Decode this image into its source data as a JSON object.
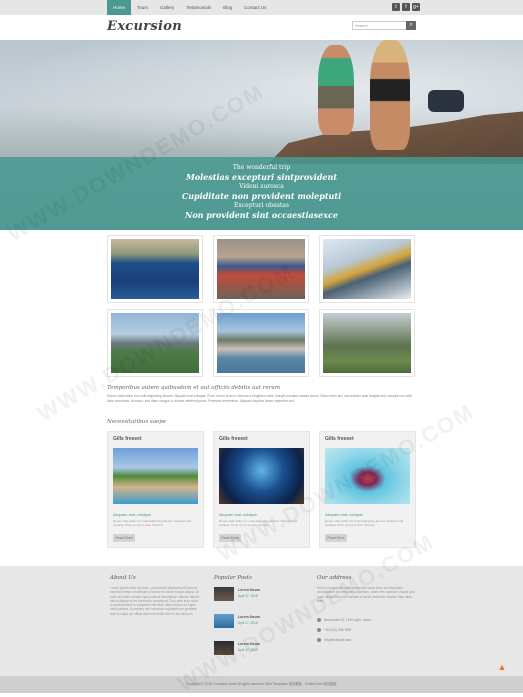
{
  "nav": {
    "items": [
      "Home",
      "Tours",
      "Gallery",
      "Testimonials",
      "Blog",
      "Contact Us"
    ],
    "active_index": 0
  },
  "social": [
    "twitter-icon",
    "facebook-icon",
    "google-plus-icon"
  ],
  "social_glyphs": [
    "t",
    "f",
    "g+"
  ],
  "header": {
    "logo": "Excursion",
    "search_placeholder": "Search"
  },
  "hero": {
    "lines": [
      "The wonderful trip",
      "Molestias excepturi sintprovident",
      "Videni surosca",
      "Cupiditate non provident moleptuti",
      "Excepturi obnstas",
      "Non provident sint occaestiasexce"
    ]
  },
  "gallery_alt": [
    "jet-ski-photo",
    "tourist-photo",
    "train-photo",
    "bridge-city-photo",
    "mountain-lake-photo",
    "machu-picchu-photo"
  ],
  "intro": {
    "title": "Temporibus autem quibusdam et aut officiis debitis aut rerum",
    "text": "Donec vitae tellus non velit adipiscing laoreet. Aliquam erat volutpat. Proin ut orci et arcu rhoncus a fringilla in ante. Integer posuere massa lectus. Etiam enim dui, consectetur quis fringilla sed, suscipit non velit. Nam commodo, rhoncus, sed diam congue a, dictum eleifend ipsum. Praesent fermentum. Aliquam dapibus lorem imperdiet orci."
  },
  "section_title": "Necessitatibus saepe",
  "cards": [
    {
      "title": "Gills freeeet",
      "subtitle": "Aliquam erat volutpat",
      "text": "Donec vitae tellus non velit adipiscing laoreet. Aliquam erat volutpat. Proin ut orci et arcu rhoncus.",
      "button": "Read More"
    },
    {
      "title": "Gills freeeet",
      "subtitle": "Aliquam erat volutpat",
      "text": "Donec vitae tellus non velit adipiscing laoreet. Aliquam erat volutpat. Proin ut orci et arcu rhoncus.",
      "button": "Read More"
    },
    {
      "title": "Gills freeeet",
      "subtitle": "Aliquam erat volutpat",
      "text": "Donec vitae tellus non velit adipiscing laoreet. Aliquam erat volutpat. Proin ut orci et arcu rhoncus.",
      "button": "Read More"
    }
  ],
  "footer": {
    "about_title": "About Us",
    "about_text": "Lorem ipsum dolor sit amet, consectetur adipiscing elit sed do eiusmod tempor incididunt ut labore et dolore magna aliqua. Ut enim ad minim veniam quis nostrud exercitation ullamco laboris nisi ut aliquip ex ea commodo consequat. Duis aute irure dolor in reprehenderit in voluptate velit esse cillum dolore eu fugiat nulla pariatur. Excepteur sint occaecat cupidatat non proident, sunt in culpa qui officia deserunt mollit anim id est laborum.",
    "popular_title": "Popular Posts",
    "posts": [
      {
        "title": "Lorem Ibsum",
        "date": "April 17, 2015"
      },
      {
        "title": "Lorem Ibsum",
        "date": "April 17, 2015"
      },
      {
        "title": "Lorem Ibsum",
        "date": "April 17, 2015"
      }
    ],
    "address_title": "Our address",
    "address_text": "Sed ut perspiciatis unde omnis iste natus error sit voluptatem accusantium doloremque laudantium, totam rem aperiam, eaque ipsa quae ab illo inventore veritatis et quasi architecto beatae vitae dicta sunt.",
    "contacts": [
      "Moscowkra St, 1234 Light, Jason",
      "+00 (111) 456 7890",
      "info@example.com"
    ]
  },
  "copyright": "Copyright © 2015 Company name All rights reserved. Web Templates 网站模板 - Collect from 网页模板",
  "watermark": "WWW.DOWNDEMO.COM",
  "colors": {
    "accent": "#4a9a93",
    "footer_bg": "#e7e7e7"
  }
}
